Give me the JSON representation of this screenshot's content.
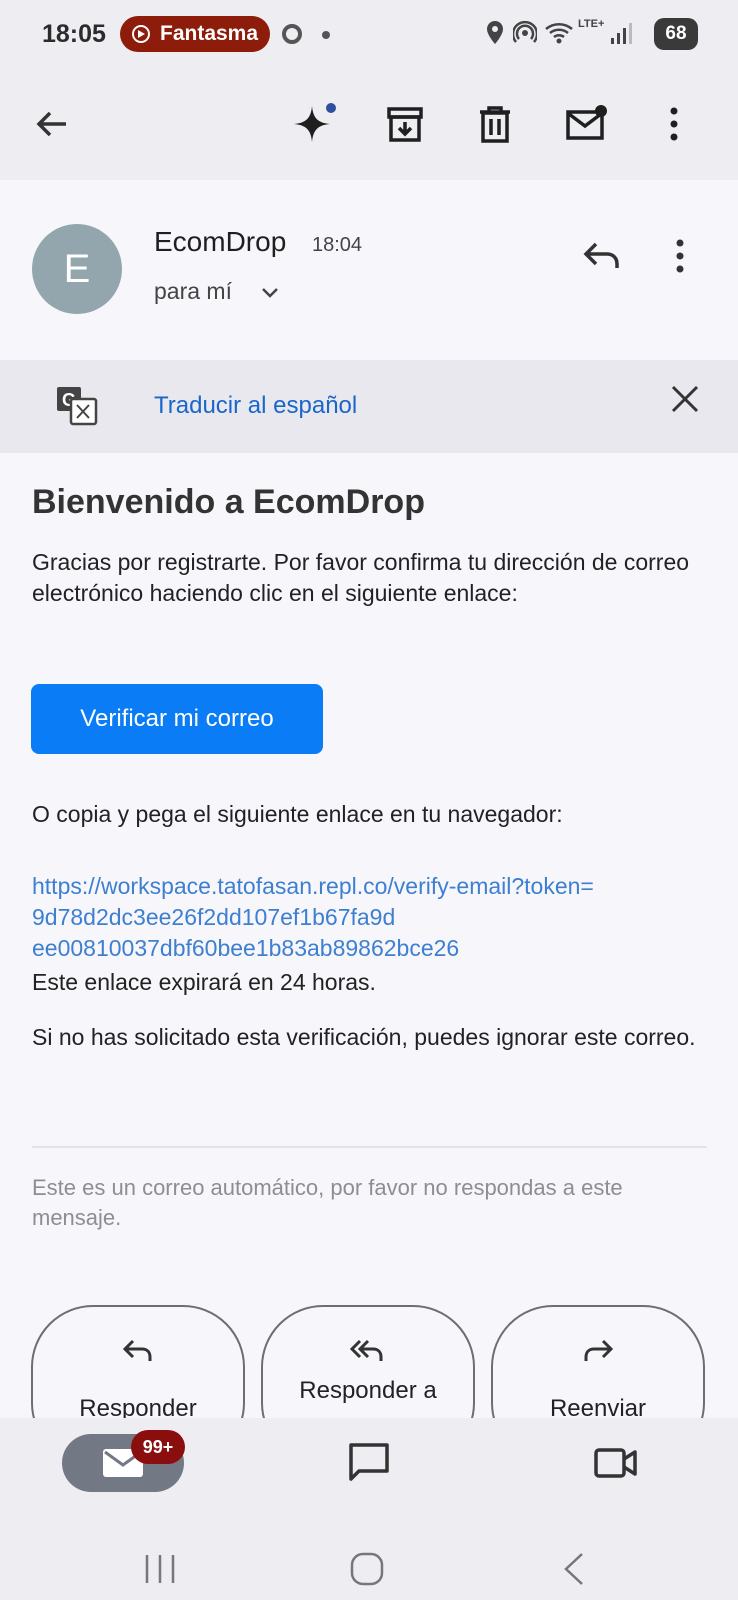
{
  "status_bar": {
    "time": "18:05",
    "notification_label": "Fantasma",
    "battery": "68",
    "network": "LTE+"
  },
  "toolbar": {
    "back_icon": "arrow-left-icon",
    "gemini_icon": "sparkle-icon",
    "archive_icon": "archive-icon",
    "delete_icon": "trash-icon",
    "mark_unread_icon": "mail-unread-icon",
    "more_icon": "more-vert-icon"
  },
  "email": {
    "avatar_letter": "E",
    "sender": "EcomDrop",
    "time": "18:04",
    "recipient": "para mí"
  },
  "translate_bar": {
    "label": "Traducir al español"
  },
  "body": {
    "heading": "Bienvenido a EcomDrop",
    "intro": "Gracias por registrarte. Por favor confirma tu dirección de correo electrónico haciendo clic en el siguiente enlace:",
    "verify_button": "Verificar mi correo",
    "copy_text": "O copia y pega el siguiente enlace en tu navegador:",
    "link_line1": "https://workspace.tatofasan.repl.co/verify-email?token=",
    "link_line2": "9d78d2dc3ee26f2dd107ef1b67fa9d",
    "link_line3": "ee00810037dbf60bee1b83ab89862bce26",
    "expiry": "Este enlace expirará en 24 horas.",
    "ignore": "Si no has solicitado esta verificación, puedes ignorar este correo.",
    "footer": "Este es un correo automático, por favor no respondas a este mensaje."
  },
  "actions": {
    "reply": "Responder",
    "reply_all": "Responder a",
    "forward": "Reenviar"
  },
  "bottom_nav": {
    "mail_badge": "99+",
    "mail_icon": "mail-icon",
    "chat_icon": "chat-icon",
    "meet_icon": "video-icon"
  },
  "colors": {
    "accent_button": "#0a7cf5",
    "link": "#3d7fd0",
    "badge": "#8a0e0e",
    "notification_pill": "#8d1c0b"
  }
}
